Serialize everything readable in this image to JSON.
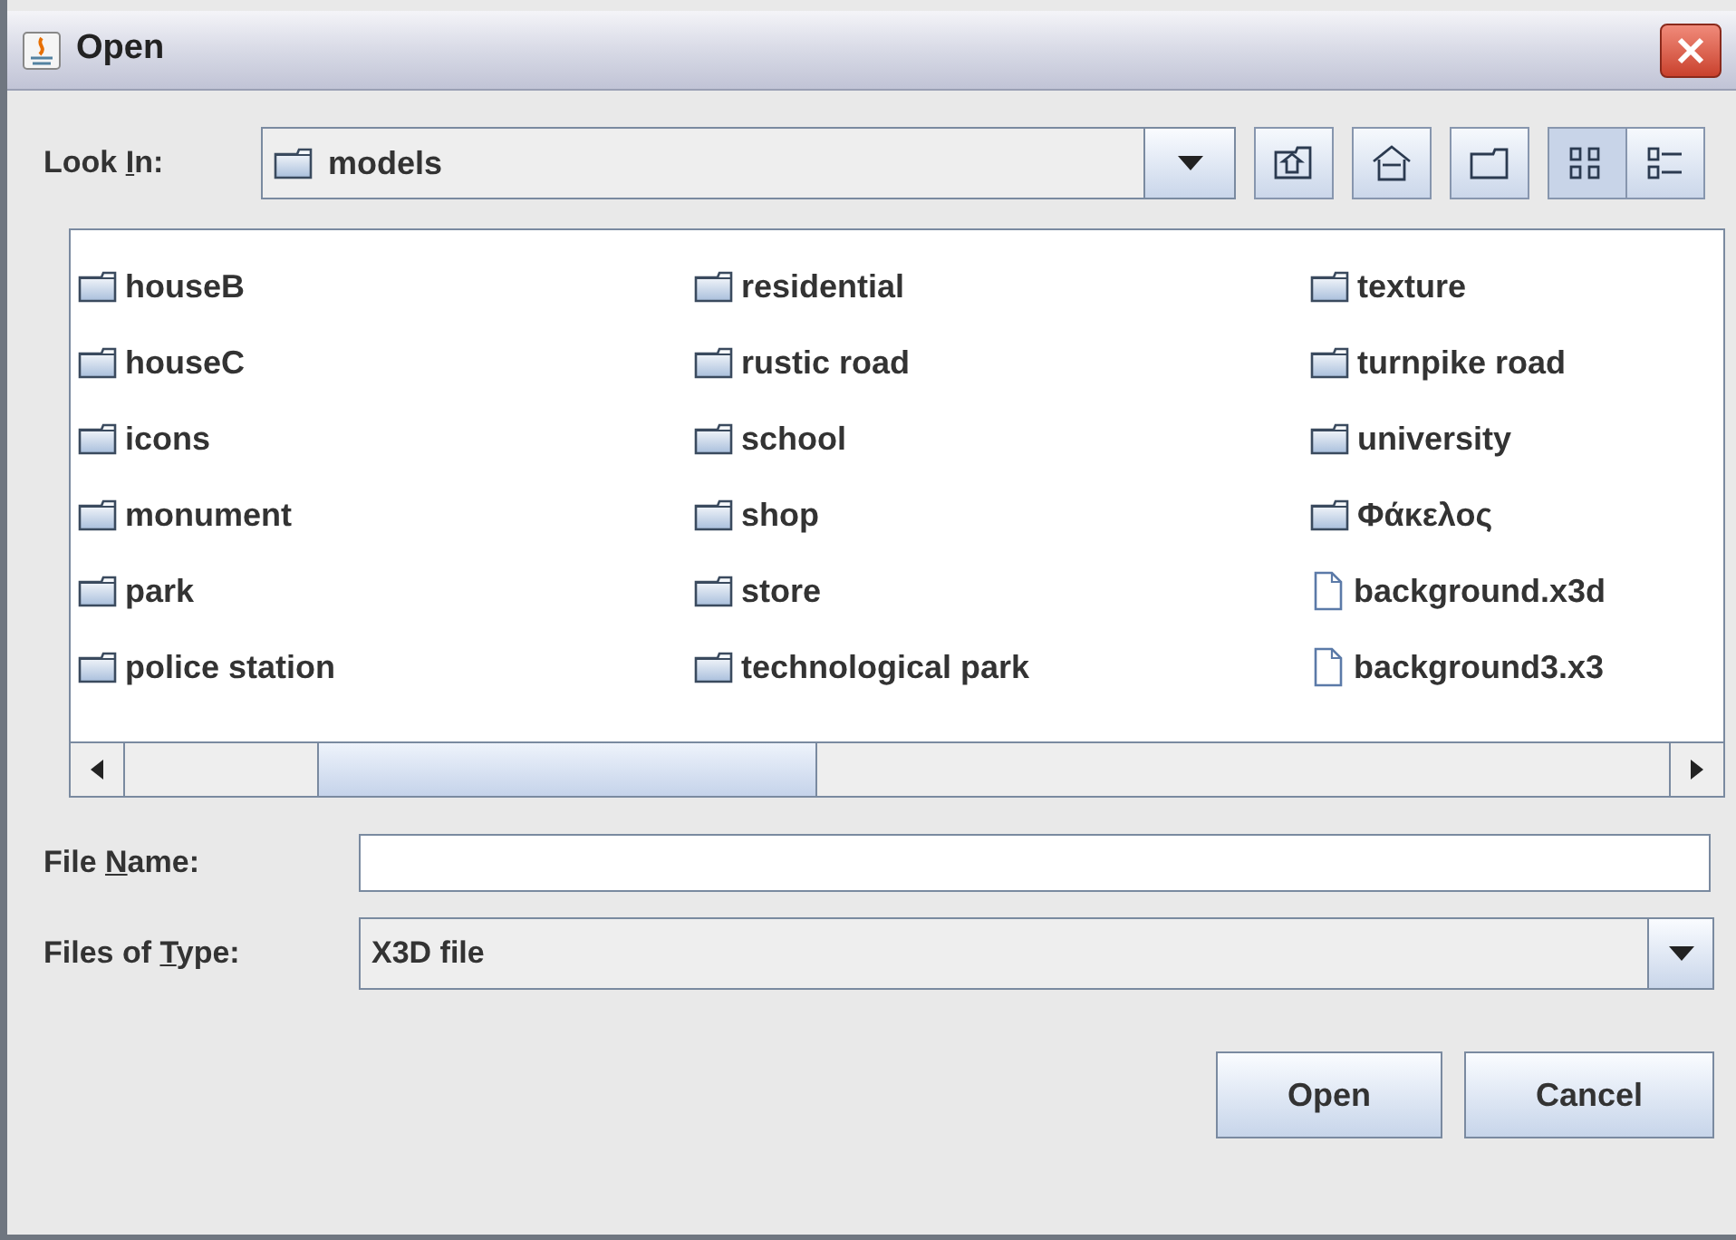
{
  "window": {
    "title": "Open"
  },
  "look_in": {
    "label_parts": [
      "Look ",
      "I",
      "n:"
    ],
    "value": "models"
  },
  "toolbar": [
    {
      "kind": "up",
      "selected": false
    },
    {
      "kind": "home",
      "selected": false
    },
    {
      "kind": "new-folder",
      "selected": false
    },
    {
      "kind": "list",
      "selected": true
    },
    {
      "kind": "details",
      "selected": false
    }
  ],
  "files": [
    {
      "name": "houseB",
      "kind": "folder"
    },
    {
      "name": "houseC",
      "kind": "folder"
    },
    {
      "name": "icons",
      "kind": "folder"
    },
    {
      "name": "monument",
      "kind": "folder"
    },
    {
      "name": "park",
      "kind": "folder"
    },
    {
      "name": "police station",
      "kind": "folder"
    },
    {
      "name": "residential",
      "kind": "folder"
    },
    {
      "name": "rustic road",
      "kind": "folder"
    },
    {
      "name": "school",
      "kind": "folder"
    },
    {
      "name": "shop",
      "kind": "folder"
    },
    {
      "name": "store",
      "kind": "folder"
    },
    {
      "name": "technological park",
      "kind": "folder"
    },
    {
      "name": "texture",
      "kind": "folder"
    },
    {
      "name": "turnpike road",
      "kind": "folder"
    },
    {
      "name": "university",
      "kind": "folder"
    },
    {
      "name": "Φάκελος",
      "kind": "folder"
    },
    {
      "name": "background.x3d",
      "kind": "file"
    },
    {
      "name": "background3.x3",
      "kind": "file"
    }
  ],
  "file_name": {
    "label_parts": [
      "File ",
      "N",
      "ame:"
    ]
  },
  "file_type": {
    "label_parts": [
      "Files of ",
      "T",
      "ype:"
    ],
    "value": "X3D file"
  },
  "buttons": [
    "Open",
    "Cancel"
  ]
}
